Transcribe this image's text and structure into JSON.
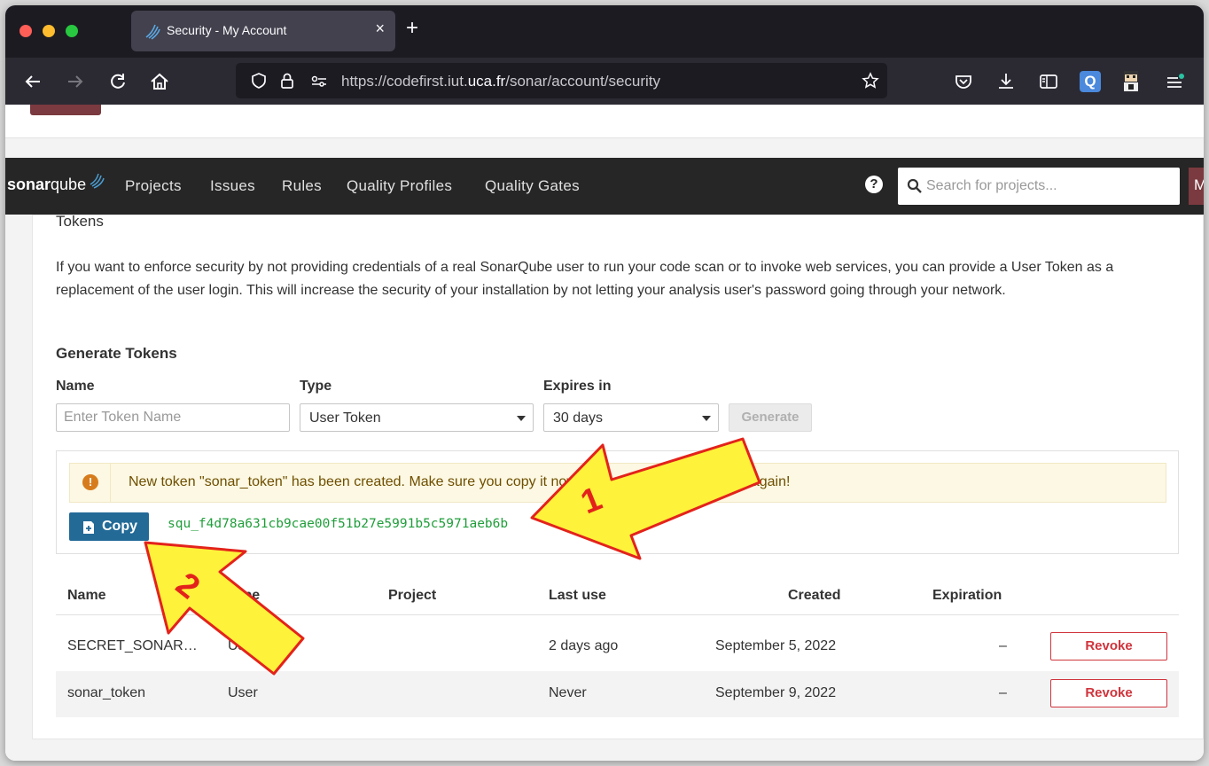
{
  "browser": {
    "tab_title": "Security - My Account",
    "tab_close": "×",
    "new_tab": "+",
    "url_prefix": "https://codefirst.iut.",
    "url_domain": "uca.fr",
    "url_path": "/sonar/account/security"
  },
  "sonar_nav": {
    "logo_bold": "sonar",
    "logo_light": "qube",
    "items": [
      "Projects",
      "Issues",
      "Rules",
      "Quality Profiles",
      "Quality Gates"
    ],
    "help": "?",
    "search_placeholder": "Search for projects...",
    "avatar": "M"
  },
  "tokens": {
    "title": "Tokens",
    "description": "If you want to enforce security by not providing credentials of a real SonarQube user to run your code scan or to invoke web services, you can provide a User Token as a replacement of the user login. This will increase the security of your installation by not letting your analysis user's password going through your network.",
    "generate_title": "Generate Tokens",
    "name_label": "Name",
    "name_placeholder": "Enter Token Name",
    "type_label": "Type",
    "type_value": "User Token",
    "expires_label": "Expires in",
    "expires_value": "30 days",
    "generate_button": "Generate",
    "alert_icon": "!",
    "alert_text": "New token \"sonar_token\" has been created. Make sure you copy it now, you won't be able to see it again!",
    "copy_button": "Copy",
    "token_value": "squ_f4d78a631cb9cae00f51b27e5991b5c5971aeb6b"
  },
  "table": {
    "headers": [
      "Name",
      "Type",
      "Project",
      "Last use",
      "Created",
      "Expiration"
    ],
    "rows": [
      {
        "name": "SECRET_SONAR…",
        "type": "User",
        "project": "",
        "last_use": "2 days ago",
        "created": "September 5, 2022",
        "expiration": "–",
        "action": "Revoke"
      },
      {
        "name": "sonar_token",
        "type": "User",
        "project": "",
        "last_use": "Never",
        "created": "September 9, 2022",
        "expiration": "–",
        "action": "Revoke"
      }
    ]
  },
  "annotations": {
    "arrow1_label": "1",
    "arrow2_label": "2",
    "fill_color": "#fff23a",
    "stroke_color": "#e3231b"
  },
  "colors": {
    "copy_button": "#236a97",
    "token_text": "#1f9e3a",
    "revoke": "#d0343c",
    "alert_bg": "#fcf8e3"
  }
}
